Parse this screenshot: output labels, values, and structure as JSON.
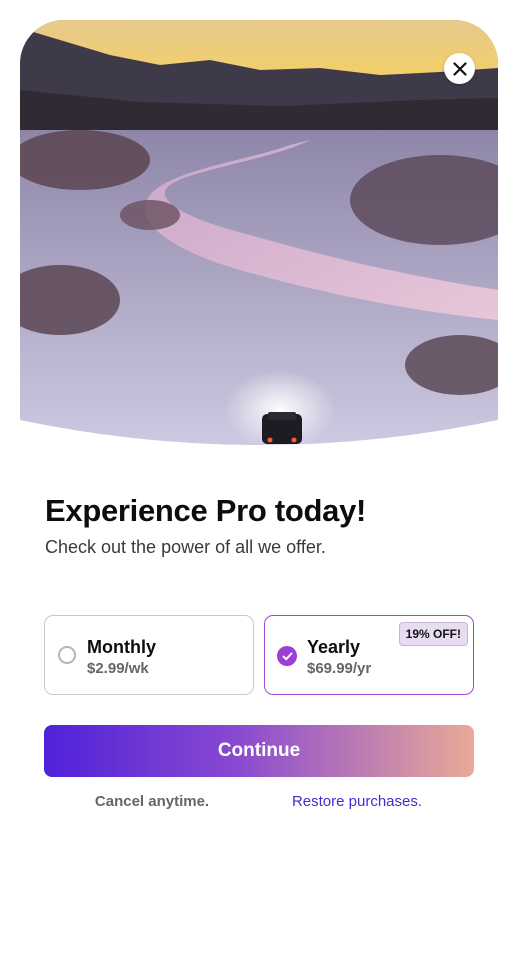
{
  "hero": {
    "image_description": "snowy river valley at dusk with a car driving, headlights on"
  },
  "close": {
    "icon": "close-icon"
  },
  "heading": {
    "title": "Experience Pro today!",
    "subtitle": "Check out the power of all we offer."
  },
  "plans": [
    {
      "name": "Monthly",
      "price": "$2.99/wk",
      "selected": false
    },
    {
      "name": "Yearly",
      "price": "$69.99/yr",
      "selected": true,
      "badge": "19% OFF!"
    }
  ],
  "continue": {
    "label": "Continue"
  },
  "footer": {
    "cancel": "Cancel anytime.",
    "restore": "Restore purchases."
  },
  "colors": {
    "accent": "#9b3fd1",
    "button_gradient_start": "#4f22d9",
    "button_gradient_end": "#e9aa98",
    "link": "#4a2ad0"
  }
}
